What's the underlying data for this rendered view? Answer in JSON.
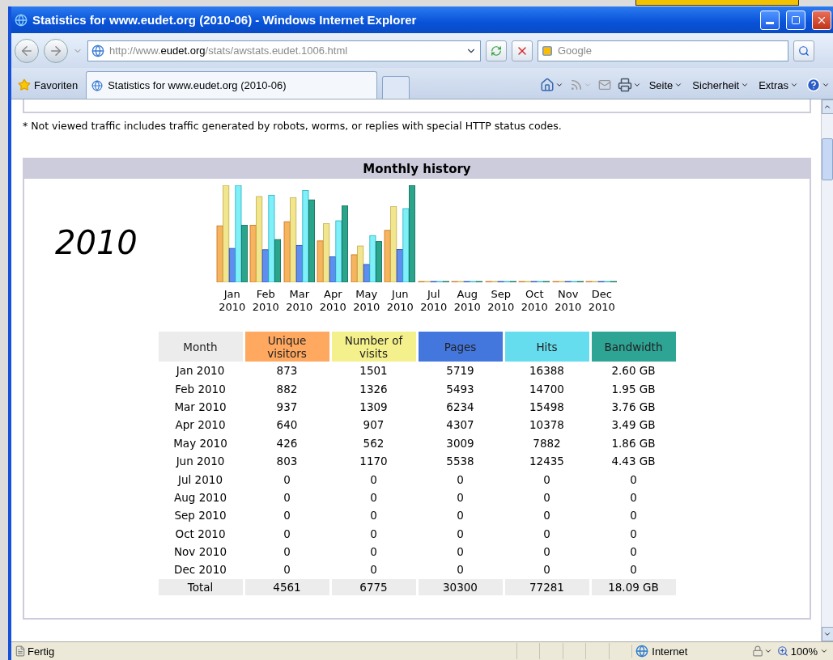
{
  "window": {
    "title": "Statistics for www.eudet.org (2010-06) - Windows Internet Explorer"
  },
  "address": {
    "url_prefix": "http://www.",
    "url_domain": "eudet.org",
    "url_path": "/stats/awstats.eudet.1006.html"
  },
  "search": {
    "placeholder": "Google"
  },
  "favorites": "Favoriten",
  "tabs": [
    {
      "label": "Statistics for www.eudet.org (2010-06)",
      "selected": true
    }
  ],
  "menus": [
    "Seite",
    "Sicherheit",
    "Extras"
  ],
  "note": "* Not viewed traffic includes traffic generated by robots, worms, or replies with special HTTP status codes.",
  "panel": {
    "title": "Monthly history",
    "year": "2010",
    "chart_labels": [
      {
        "month": "Jan",
        "year": "2010"
      },
      {
        "month": "Feb",
        "year": "2010"
      },
      {
        "month": "Mar",
        "year": "2010"
      },
      {
        "month": "Apr",
        "year": "2010"
      },
      {
        "month": "May",
        "year": "2010"
      },
      {
        "month": "Jun",
        "year": "2010"
      },
      {
        "month": "Jul",
        "year": "2010"
      },
      {
        "month": "Aug",
        "year": "2010"
      },
      {
        "month": "Sep",
        "year": "2010"
      },
      {
        "month": "Oct",
        "year": "2010"
      },
      {
        "month": "Nov",
        "year": "2010"
      },
      {
        "month": "Dec",
        "year": "2010"
      }
    ],
    "columns": [
      {
        "label": "Month",
        "color": "#ececec"
      },
      {
        "label": "Unique visitors",
        "color": "#ffa860"
      },
      {
        "label": "Number of visits",
        "color": "#f4f08c"
      },
      {
        "label": "Pages",
        "color": "#4477dd"
      },
      {
        "label": "Hits",
        "color": "#66ddee"
      },
      {
        "label": "Bandwidth",
        "color": "#2ea495"
      }
    ],
    "rows": [
      [
        "Jan 2010",
        "873",
        "1501",
        "5719",
        "16388",
        "2.60 GB"
      ],
      [
        "Feb 2010",
        "882",
        "1326",
        "5493",
        "14700",
        "1.95 GB"
      ],
      [
        "Mar 2010",
        "937",
        "1309",
        "6234",
        "15498",
        "3.76 GB"
      ],
      [
        "Apr 2010",
        "640",
        "907",
        "4307",
        "10378",
        "3.49 GB"
      ],
      [
        "May 2010",
        "426",
        "562",
        "3009",
        "7882",
        "1.86 GB"
      ],
      [
        "Jun 2010",
        "803",
        "1170",
        "5538",
        "12435",
        "4.43 GB"
      ],
      [
        "Jul 2010",
        "0",
        "0",
        "0",
        "0",
        "0"
      ],
      [
        "Aug 2010",
        "0",
        "0",
        "0",
        "0",
        "0"
      ],
      [
        "Sep 2010",
        "0",
        "0",
        "0",
        "0",
        "0"
      ],
      [
        "Oct 2010",
        "0",
        "0",
        "0",
        "0",
        "0"
      ],
      [
        "Nov 2010",
        "0",
        "0",
        "0",
        "0",
        "0"
      ],
      [
        "Dec 2010",
        "0",
        "0",
        "0",
        "0",
        "0"
      ]
    ],
    "total": [
      "Total",
      "4561",
      "6775",
      "30300",
      "77281",
      "18.09 GB"
    ]
  },
  "status_bar": {
    "text": "Fertig",
    "zone": "Internet",
    "zoom": "100%"
  }
}
